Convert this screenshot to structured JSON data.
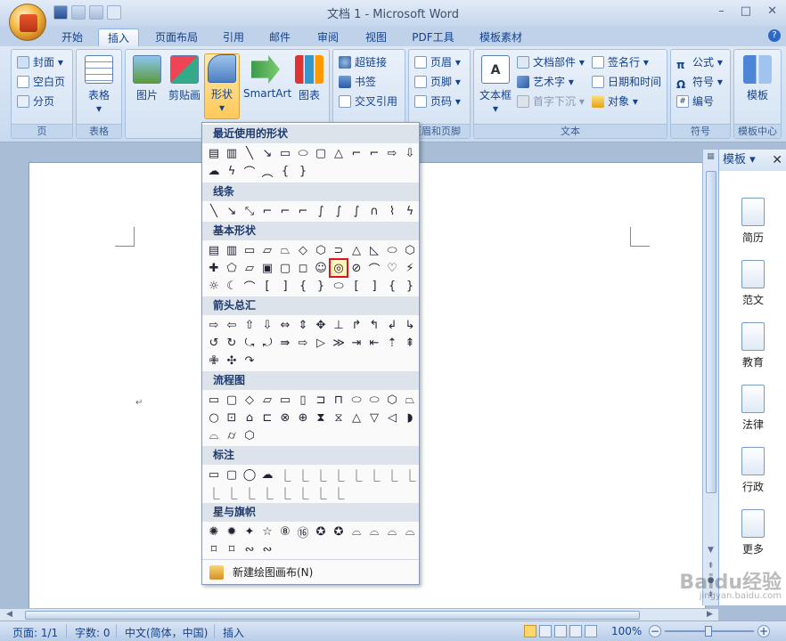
{
  "window": {
    "title": "文档 1 - Microsoft Word",
    "controls": [
      "–",
      "□",
      "✕"
    ]
  },
  "tabs": [
    "开始",
    "插入",
    "页面布局",
    "引用",
    "邮件",
    "审阅",
    "视图",
    "PDF工具",
    "模板素材"
  ],
  "active_tab": "插入",
  "ribbon": {
    "pages": {
      "label": "页",
      "items": [
        "封面",
        "空白页",
        "分页"
      ]
    },
    "tables": {
      "label": "表格",
      "button": "表格"
    },
    "illustrations": {
      "buttons": [
        "图片",
        "剪贴画",
        "形状",
        "SmartArt",
        "图表"
      ]
    },
    "links": {
      "items": [
        "超链接",
        "书签",
        "交叉引用"
      ]
    },
    "header_footer": {
      "label": "页眉和页脚",
      "items": [
        "页眉",
        "页脚",
        "页码"
      ]
    },
    "text": {
      "label": "文本",
      "textbox": "文本框",
      "items": [
        "文档部件",
        "艺术字",
        "首字下沉",
        "签名行",
        "日期和时间",
        "对象"
      ]
    },
    "symbols": {
      "label": "符号",
      "items": [
        "公式",
        "符号",
        "编号"
      ]
    },
    "templates": {
      "label": "模板中心",
      "button": "模板"
    }
  },
  "shapes_menu": {
    "sections": [
      "最近使用的形状",
      "线条",
      "基本形状",
      "箭头总汇",
      "流程图",
      "标注",
      "星与旗帜"
    ],
    "footer": "新建绘图画布(N)",
    "recent": [
      [
        "▤",
        "▥",
        "╲",
        "↘",
        "▭",
        "⬭",
        "▢",
        "△",
        "⌐",
        "⌐",
        "⇨",
        "⇩"
      ],
      [
        "☁",
        "ϟ",
        "⌒",
        "︵",
        "{",
        "}"
      ]
    ],
    "lines": [
      [
        "╲",
        "↘",
        "⤡",
        "⌐",
        "⌐",
        "⌐",
        "∫",
        "∫",
        "∫",
        "∩",
        "⌇",
        "ϟ"
      ]
    ],
    "basic": [
      [
        "▤",
        "▥",
        "▭",
        "▱",
        "⏢",
        "◇",
        "⬡",
        "⊃",
        "△",
        "◺",
        "⬭",
        "⬡"
      ],
      [
        "✚",
        "⬠",
        "▱",
        "▣",
        "▢",
        "◻",
        "☺",
        "◎",
        "⊘",
        "⌒",
        "♡",
        "⚡"
      ],
      [
        "☼",
        "☾",
        "⌒",
        "[",
        "]",
        "{",
        "}",
        "⬭",
        "[",
        "]",
        "{",
        "}"
      ]
    ],
    "arrows": [
      [
        "⇨",
        "⇦",
        "⇧",
        "⇩",
        "⇔",
        "⇕",
        "✥",
        "⊥",
        "↱",
        "↰",
        "↲",
        "↳"
      ],
      [
        "↺",
        "↻",
        "⤿",
        "⤾",
        "⇛",
        "⇨",
        "▷",
        "≫",
        "⇥",
        "⇤",
        "⇡",
        "⇞"
      ],
      [
        "✙",
        "✣",
        "↷"
      ]
    ],
    "flowchart": [
      [
        "▭",
        "▢",
        "◇",
        "▱",
        "▭",
        "▯",
        "⊐",
        "⊓",
        "⬭",
        "⬭",
        "⬡",
        "⏢"
      ],
      [
        "○",
        "⊡",
        "⌂",
        "⊏",
        "⊗",
        "⊕",
        "⧗",
        "⧖",
        "△",
        "▽",
        "◁",
        "◗"
      ],
      [
        "⌓",
        "⌭",
        "⬡"
      ]
    ],
    "callouts": [
      [
        "▭",
        "▢",
        "◯",
        "☁",
        "⎿",
        "⎿",
        "⎿",
        "⎿",
        "⎿",
        "⎿",
        "⎿",
        "⎿"
      ],
      [
        "⎿",
        "⎿",
        "⎿",
        "⎿",
        "⎿",
        "⎿",
        "⎿",
        "⎿"
      ]
    ],
    "stars": [
      [
        "✺",
        "✹",
        "✦",
        "☆",
        "⑧",
        "⑯",
        "✪",
        "✪",
        "⌓",
        "⌓",
        "⌓",
        "⌓"
      ],
      [
        "⌑",
        "⌑",
        "∾",
        "∾"
      ]
    ],
    "highlighted_shape": "donut-icon"
  },
  "taskpane": {
    "title": "模板",
    "items": [
      "简历",
      "范文",
      "教育",
      "法律",
      "行政",
      "更多"
    ]
  },
  "statusbar": {
    "page": "页面: 1/1",
    "words": "字数: 0",
    "lang": "中文(简体，中国)",
    "mode": "插入",
    "zoom": "100%"
  },
  "watermark": "Baidu经验",
  "watermark_url": "jingyan.baidu.com"
}
